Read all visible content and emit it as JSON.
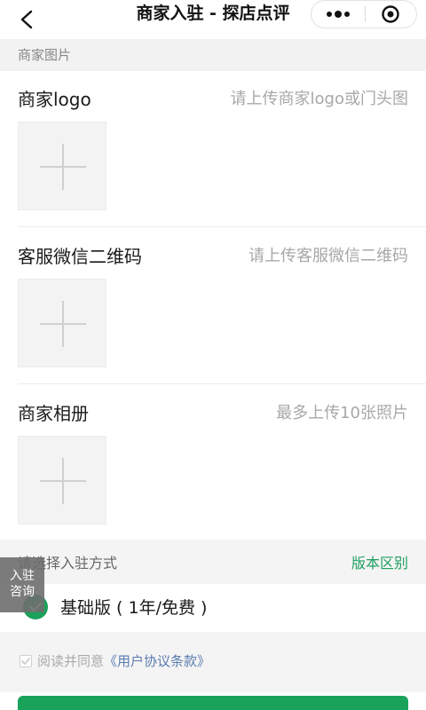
{
  "navbar": {
    "title": "商家入驻 - 探店点评",
    "back_icon": "chevron-left-icon",
    "more_icon": "more-dots-icon",
    "close_icon": "target-circle-icon"
  },
  "section_photos": {
    "header": "商家图片"
  },
  "fields": [
    {
      "label": "商家logo",
      "hint": "请上传商家logo或门头图"
    },
    {
      "label": "客服微信二维码",
      "hint": "请上传客服微信二维码"
    },
    {
      "label": "商家相册",
      "hint": "最多上传10张照片"
    }
  ],
  "method": {
    "title": "请选择入驻方式",
    "link": "版本区别",
    "plan_label": "基础版 ( 1年/免费 )"
  },
  "agreement": {
    "prefix": "阅读并同意",
    "link": "《用户协议条款》"
  },
  "float_button": {
    "line1": "入驻",
    "line2": "咨询"
  },
  "colors": {
    "accent": "#1aa25a",
    "link": "#5a7bb0",
    "hint": "#a8a8a8"
  }
}
